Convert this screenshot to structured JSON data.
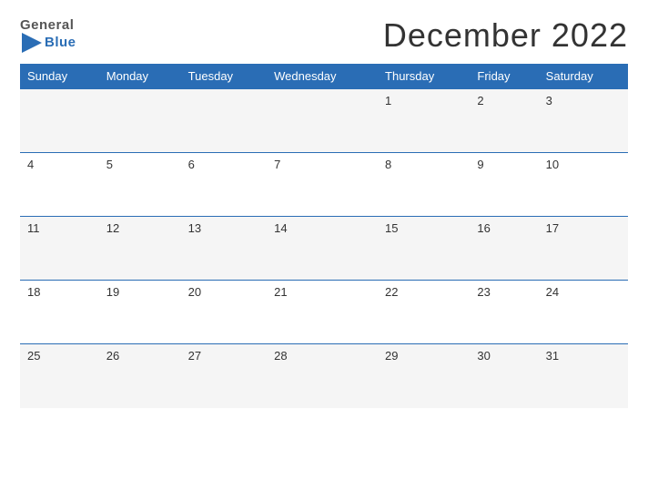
{
  "header": {
    "logo": {
      "general": "General",
      "triangle_icon": "▶",
      "blue": "Blue"
    },
    "title": "December 2022"
  },
  "weekdays": [
    "Sunday",
    "Monday",
    "Tuesday",
    "Wednesday",
    "Thursday",
    "Friday",
    "Saturday"
  ],
  "weeks": [
    [
      null,
      null,
      null,
      null,
      1,
      2,
      3
    ],
    [
      4,
      5,
      6,
      7,
      8,
      9,
      10
    ],
    [
      11,
      12,
      13,
      14,
      15,
      16,
      17
    ],
    [
      18,
      19,
      20,
      21,
      22,
      23,
      24
    ],
    [
      25,
      26,
      27,
      28,
      29,
      30,
      31
    ]
  ],
  "colors": {
    "header_bg": "#2a6db5",
    "logo_blue": "#2a6db5",
    "odd_row_bg": "#f5f5f5",
    "even_row_bg": "#ffffff",
    "border": "#2a6db5"
  }
}
